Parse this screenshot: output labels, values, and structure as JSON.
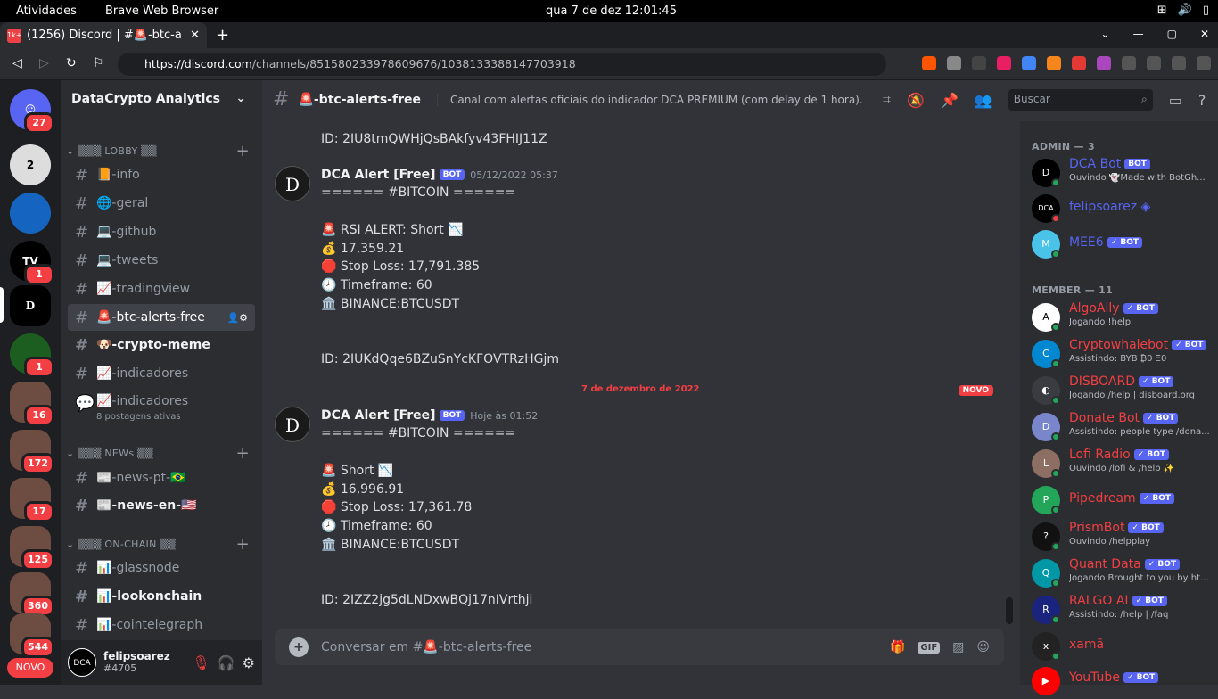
{
  "os": {
    "activities": "Atividades",
    "app": "Brave Web Browser",
    "clock": "qua 7 de dez  12:01:45"
  },
  "browser": {
    "tab_title": "(1256) Discord | #🚨-btc-a",
    "tab_badge": "1k+",
    "url_host": "https://discord.com",
    "url_path": "/channels/851580233978609676/1038133388147703918"
  },
  "servers": [
    {
      "label": "27"
    },
    {
      "label": "1"
    },
    {
      "label": "1"
    },
    {
      "label": "16"
    },
    {
      "label": "172"
    },
    {
      "label": "17"
    },
    {
      "label": "125"
    },
    {
      "label": "360"
    },
    {
      "label": "544"
    }
  ],
  "novo": "NOVO",
  "guild": {
    "name": "DataCrypto Analytics"
  },
  "categories": {
    "lobby": "LOBBY",
    "news": "NEWs",
    "onchain": "ON-CHAIN"
  },
  "channels": [
    "📙-info",
    "🌐-geral",
    "💻-github",
    "💻-tweets",
    "📈-tradingview",
    "🚨-btc-alerts-free",
    "🐶-crypto-meme",
    "📈-indicadores",
    "📈-indicadores",
    "📰-news-pt-🇧🇷",
    "📰-news-en-🇺🇸",
    "📊-glassnode",
    "📊-lookonchain",
    "📊-cointelegraph"
  ],
  "forum_sub": "8 postagens ativas",
  "user": {
    "name": "felipsoarez",
    "tag": "#4705",
    "avatar": "DCA"
  },
  "channel_head": {
    "name": "🚨-btc-alerts-free",
    "topic": "Canal com alertas oficiais do indicador DCA PREMIUM (com delay de 1 hora).",
    "search": "Buscar"
  },
  "messages": {
    "prev_id": "ID: 2IU8tmQWHjQsBAkfyv43FHIJ11Z",
    "m1": {
      "author": "DCA Alert [Free]",
      "bot": "BOT",
      "time": "05/12/2022 05:37",
      "lines": [
        "====== #BITCOIN ======",
        "🚨 RSI ALERT: Short 📉",
        "💰 17,359.21",
        "🛑 Stop Loss: 17,791.385",
        "🕗 Timeframe: 60",
        "🏛️ BINANCE:BTCUSDT",
        "ID: 2IUKdQqe6BZuSnYcKFOVTRzHGjm"
      ]
    },
    "divider": "7 de dezembro de 2022",
    "divider_new": "NOVO",
    "m2": {
      "author": "DCA Alert [Free]",
      "bot": "BOT",
      "time": "Hoje às 01:52",
      "lines": [
        "====== #BITCOIN ======",
        "🚨 Short 📉",
        "💰 16,996.91",
        "🛑 Stop Loss: 17,361.78",
        "🕗 Timeframe: 60",
        "🏛️ BINANCE:BTCUSDT",
        "ID: 2IZZ2jg5dLNDxwBQj17nIVrthji"
      ]
    }
  },
  "composer": {
    "placeholder": "Conversar em #🚨-btc-alerts-free",
    "gif": "GIF"
  },
  "members": {
    "admin_title": "ADMIN — 3",
    "member_title": "MEMBER — 11",
    "admins": [
      {
        "name": "DCA Bot",
        "bot": "BOT",
        "act": "Ouvindo 👻Made with BotGh...",
        "color": "#5865f2"
      },
      {
        "name": "felipsoarez ◈",
        "bot": "",
        "act": "",
        "color": "#5865f2"
      },
      {
        "name": "MEE6",
        "bot": "✓ BOT",
        "act": "",
        "color": "#5865f2"
      }
    ],
    "list": [
      {
        "name": "AlgoAlly",
        "bot": "✓ BOT",
        "act": "Jogando !help"
      },
      {
        "name": "Cryptowhalebot",
        "bot": "✓ BOT",
        "act": "Assistindo: BYB ₿0 Ξ0"
      },
      {
        "name": "DISBOARD",
        "bot": "✓ BOT",
        "act": "Jogando /help | disboard.org"
      },
      {
        "name": "Donate Bot",
        "bot": "✓ BOT",
        "act": "Assistindo: people type /dona..."
      },
      {
        "name": "Lofi Radio",
        "bot": "✓ BOT",
        "act": "Ouvindo /lofi & /help ✨"
      },
      {
        "name": "Pipedream",
        "bot": "✓ BOT",
        "act": ""
      },
      {
        "name": "PrismBot",
        "bot": "✓ BOT",
        "act": "Ouvindo /helpplay"
      },
      {
        "name": "Quant Data",
        "bot": "✓ BOT",
        "act": "Jogando Brought to you by ht..."
      },
      {
        "name": "RALGO AI",
        "bot": "✓ BOT",
        "act": "Assistindo: /help | /faq"
      },
      {
        "name": "xamã",
        "bot": "",
        "act": ""
      },
      {
        "name": "YouTube",
        "bot": "✓ BOT",
        "act": ""
      }
    ]
  },
  "colors": {
    "member_red": "#f23f43",
    "accent": "#5865f2"
  }
}
